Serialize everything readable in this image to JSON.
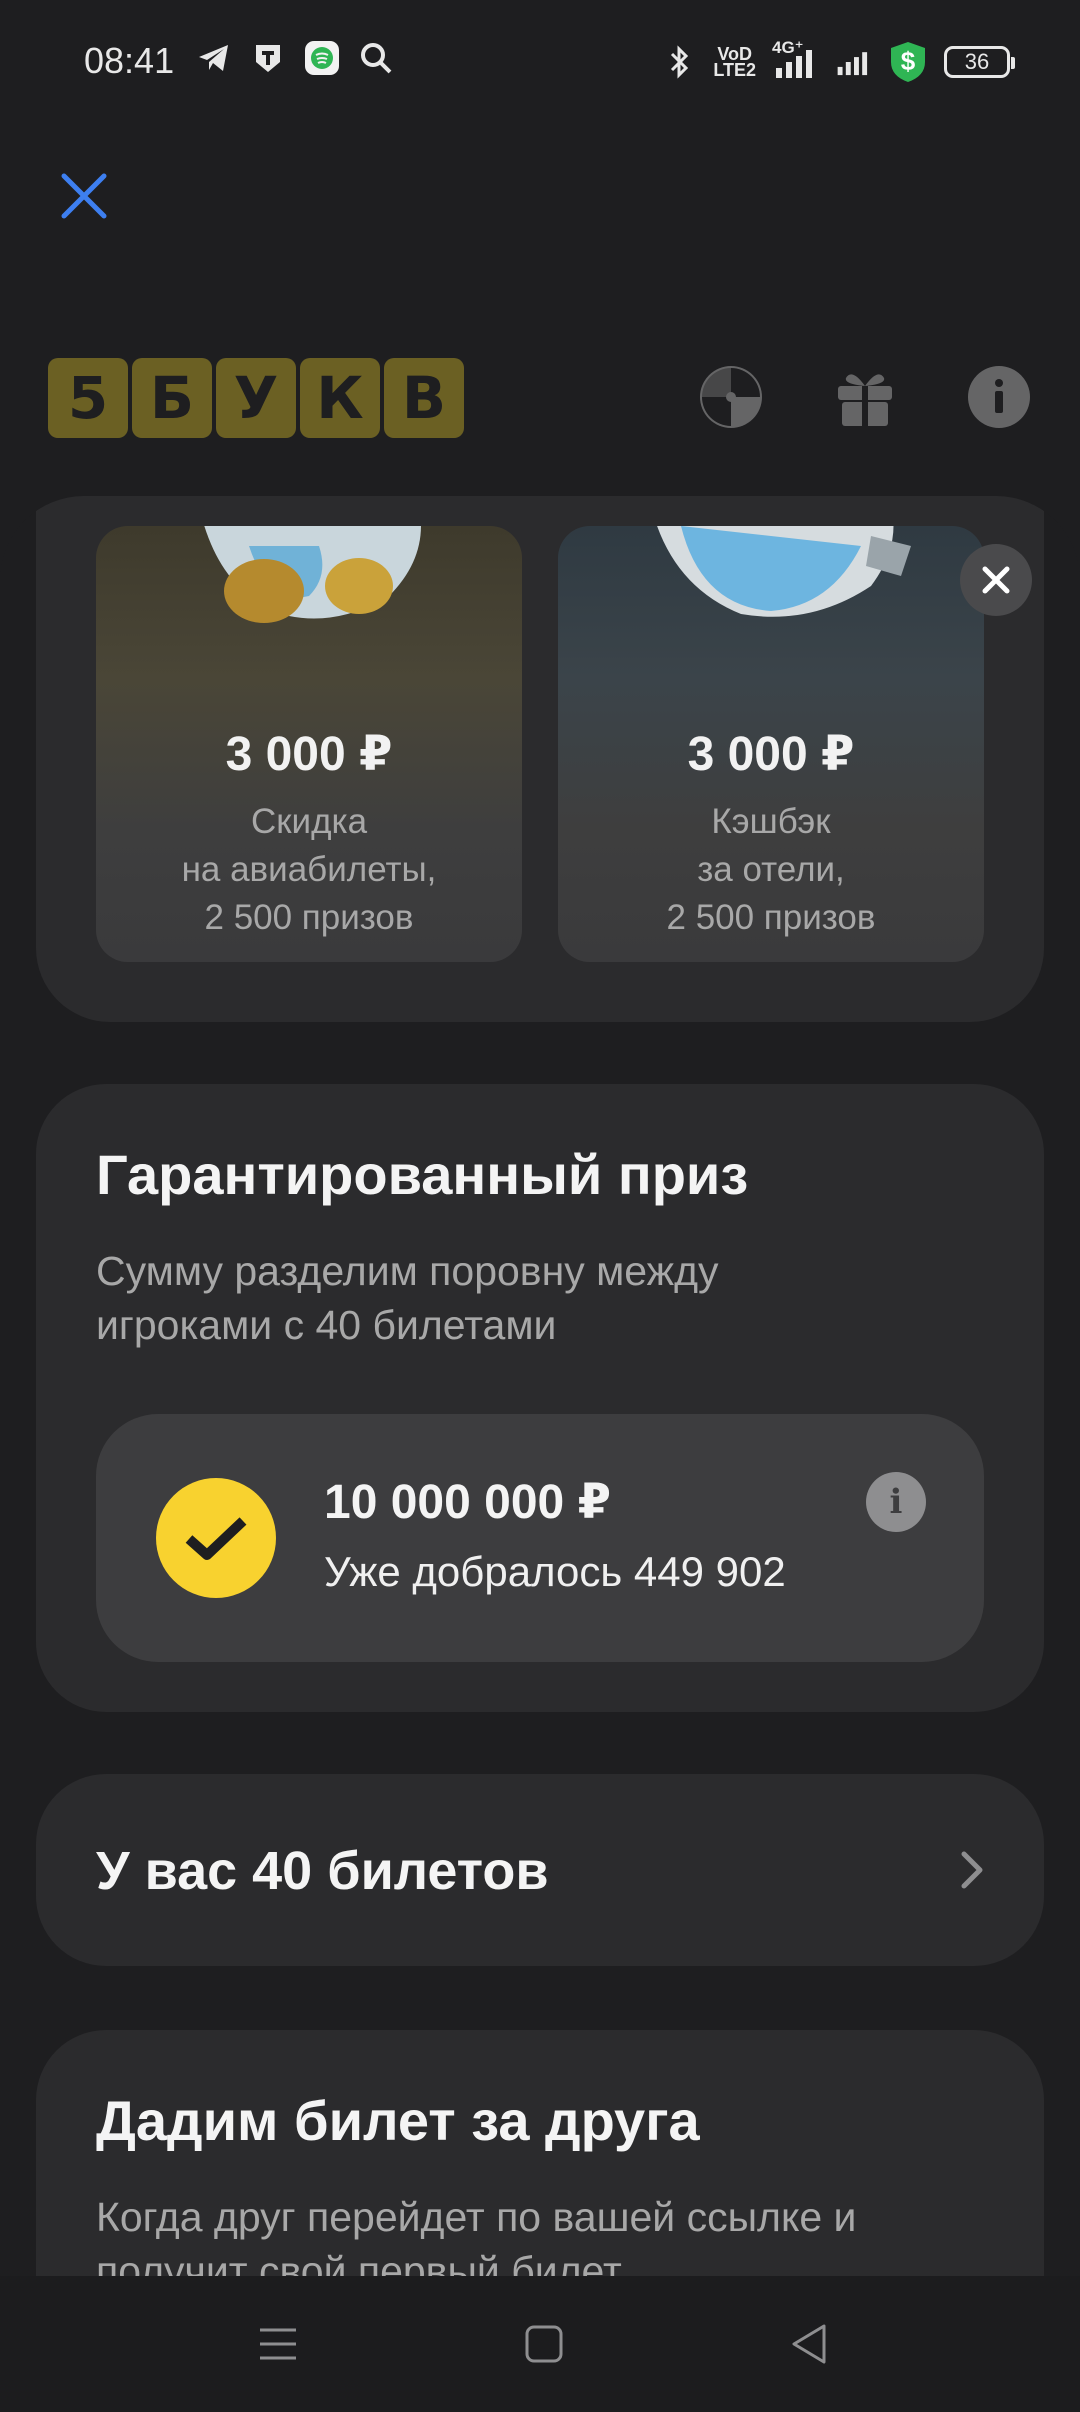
{
  "status_bar": {
    "time": "08:41",
    "left_icons": [
      "telegram-icon",
      "t-app-icon",
      "messenger-icon",
      "search-icon"
    ],
    "network_label_1": "VoD",
    "network_label_2": "LTE2",
    "network_4g": "4G⁺",
    "battery": "36",
    "vpn_symbol": "$"
  },
  "game": {
    "logo_letters": [
      "5",
      "Б",
      "У",
      "К",
      "В"
    ],
    "header_icons": [
      "wheel-icon",
      "gift-icon",
      "info-icon"
    ]
  },
  "prizes": [
    {
      "amount": "3 000 ₽",
      "lines": [
        "Скидка",
        "на авиабилеты,",
        "2 500 призов"
      ]
    },
    {
      "amount": "3 000 ₽",
      "lines": [
        "Кэшбэк",
        "за отели,",
        "2 500 призов"
      ]
    }
  ],
  "guaranteed": {
    "title": "Гарантированный приз",
    "subtitle": "Сумму разделим поровну между игроками с 40 билетами",
    "amount": "10 000 000 ₽",
    "progress_text": "Уже добралось 449 902",
    "info_symbol": "i"
  },
  "tickets": {
    "label": "У вас 40 билетов"
  },
  "friend": {
    "title": "Дадим билет за друга",
    "subtitle": "Когда друг перейдет по вашей ссылке и получит свой первый билет"
  },
  "colors": {
    "background": "#1e1e20",
    "card": "#2b2b2d",
    "inner_card": "#3d3d3f",
    "accent_blue": "#3d7ff0",
    "coin_yellow": "#f8d22f",
    "logo_yellow": "#e9cd2a",
    "vpn_green": "#2fb554"
  }
}
